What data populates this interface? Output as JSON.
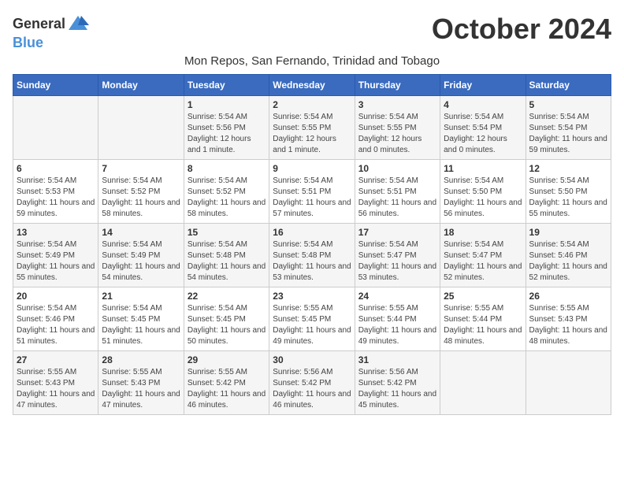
{
  "header": {
    "logo_general": "General",
    "logo_blue": "Blue",
    "month_title": "October 2024",
    "location": "Mon Repos, San Fernando, Trinidad and Tobago"
  },
  "days_of_week": [
    "Sunday",
    "Monday",
    "Tuesday",
    "Wednesday",
    "Thursday",
    "Friday",
    "Saturday"
  ],
  "weeks": [
    [
      {
        "day": "",
        "info": ""
      },
      {
        "day": "",
        "info": ""
      },
      {
        "day": "1",
        "info": "Sunrise: 5:54 AM\nSunset: 5:56 PM\nDaylight: 12 hours\nand 1 minute."
      },
      {
        "day": "2",
        "info": "Sunrise: 5:54 AM\nSunset: 5:55 PM\nDaylight: 12 hours\nand 1 minute."
      },
      {
        "day": "3",
        "info": "Sunrise: 5:54 AM\nSunset: 5:55 PM\nDaylight: 12 hours\nand 0 minutes."
      },
      {
        "day": "4",
        "info": "Sunrise: 5:54 AM\nSunset: 5:54 PM\nDaylight: 12 hours\nand 0 minutes."
      },
      {
        "day": "5",
        "info": "Sunrise: 5:54 AM\nSunset: 5:54 PM\nDaylight: 11 hours\nand 59 minutes."
      }
    ],
    [
      {
        "day": "6",
        "info": "Sunrise: 5:54 AM\nSunset: 5:53 PM\nDaylight: 11 hours\nand 59 minutes."
      },
      {
        "day": "7",
        "info": "Sunrise: 5:54 AM\nSunset: 5:52 PM\nDaylight: 11 hours\nand 58 minutes."
      },
      {
        "day": "8",
        "info": "Sunrise: 5:54 AM\nSunset: 5:52 PM\nDaylight: 11 hours\nand 58 minutes."
      },
      {
        "day": "9",
        "info": "Sunrise: 5:54 AM\nSunset: 5:51 PM\nDaylight: 11 hours\nand 57 minutes."
      },
      {
        "day": "10",
        "info": "Sunrise: 5:54 AM\nSunset: 5:51 PM\nDaylight: 11 hours\nand 56 minutes."
      },
      {
        "day": "11",
        "info": "Sunrise: 5:54 AM\nSunset: 5:50 PM\nDaylight: 11 hours\nand 56 minutes."
      },
      {
        "day": "12",
        "info": "Sunrise: 5:54 AM\nSunset: 5:50 PM\nDaylight: 11 hours\nand 55 minutes."
      }
    ],
    [
      {
        "day": "13",
        "info": "Sunrise: 5:54 AM\nSunset: 5:49 PM\nDaylight: 11 hours\nand 55 minutes."
      },
      {
        "day": "14",
        "info": "Sunrise: 5:54 AM\nSunset: 5:49 PM\nDaylight: 11 hours\nand 54 minutes."
      },
      {
        "day": "15",
        "info": "Sunrise: 5:54 AM\nSunset: 5:48 PM\nDaylight: 11 hours\nand 54 minutes."
      },
      {
        "day": "16",
        "info": "Sunrise: 5:54 AM\nSunset: 5:48 PM\nDaylight: 11 hours\nand 53 minutes."
      },
      {
        "day": "17",
        "info": "Sunrise: 5:54 AM\nSunset: 5:47 PM\nDaylight: 11 hours\nand 53 minutes."
      },
      {
        "day": "18",
        "info": "Sunrise: 5:54 AM\nSunset: 5:47 PM\nDaylight: 11 hours\nand 52 minutes."
      },
      {
        "day": "19",
        "info": "Sunrise: 5:54 AM\nSunset: 5:46 PM\nDaylight: 11 hours\nand 52 minutes."
      }
    ],
    [
      {
        "day": "20",
        "info": "Sunrise: 5:54 AM\nSunset: 5:46 PM\nDaylight: 11 hours\nand 51 minutes."
      },
      {
        "day": "21",
        "info": "Sunrise: 5:54 AM\nSunset: 5:45 PM\nDaylight: 11 hours\nand 51 minutes."
      },
      {
        "day": "22",
        "info": "Sunrise: 5:54 AM\nSunset: 5:45 PM\nDaylight: 11 hours\nand 50 minutes."
      },
      {
        "day": "23",
        "info": "Sunrise: 5:55 AM\nSunset: 5:45 PM\nDaylight: 11 hours\nand 49 minutes."
      },
      {
        "day": "24",
        "info": "Sunrise: 5:55 AM\nSunset: 5:44 PM\nDaylight: 11 hours\nand 49 minutes."
      },
      {
        "day": "25",
        "info": "Sunrise: 5:55 AM\nSunset: 5:44 PM\nDaylight: 11 hours\nand 48 minutes."
      },
      {
        "day": "26",
        "info": "Sunrise: 5:55 AM\nSunset: 5:43 PM\nDaylight: 11 hours\nand 48 minutes."
      }
    ],
    [
      {
        "day": "27",
        "info": "Sunrise: 5:55 AM\nSunset: 5:43 PM\nDaylight: 11 hours\nand 47 minutes."
      },
      {
        "day": "28",
        "info": "Sunrise: 5:55 AM\nSunset: 5:43 PM\nDaylight: 11 hours\nand 47 minutes."
      },
      {
        "day": "29",
        "info": "Sunrise: 5:55 AM\nSunset: 5:42 PM\nDaylight: 11 hours\nand 46 minutes."
      },
      {
        "day": "30",
        "info": "Sunrise: 5:56 AM\nSunset: 5:42 PM\nDaylight: 11 hours\nand 46 minutes."
      },
      {
        "day": "31",
        "info": "Sunrise: 5:56 AM\nSunset: 5:42 PM\nDaylight: 11 hours\nand 45 minutes."
      },
      {
        "day": "",
        "info": ""
      },
      {
        "day": "",
        "info": ""
      }
    ]
  ]
}
